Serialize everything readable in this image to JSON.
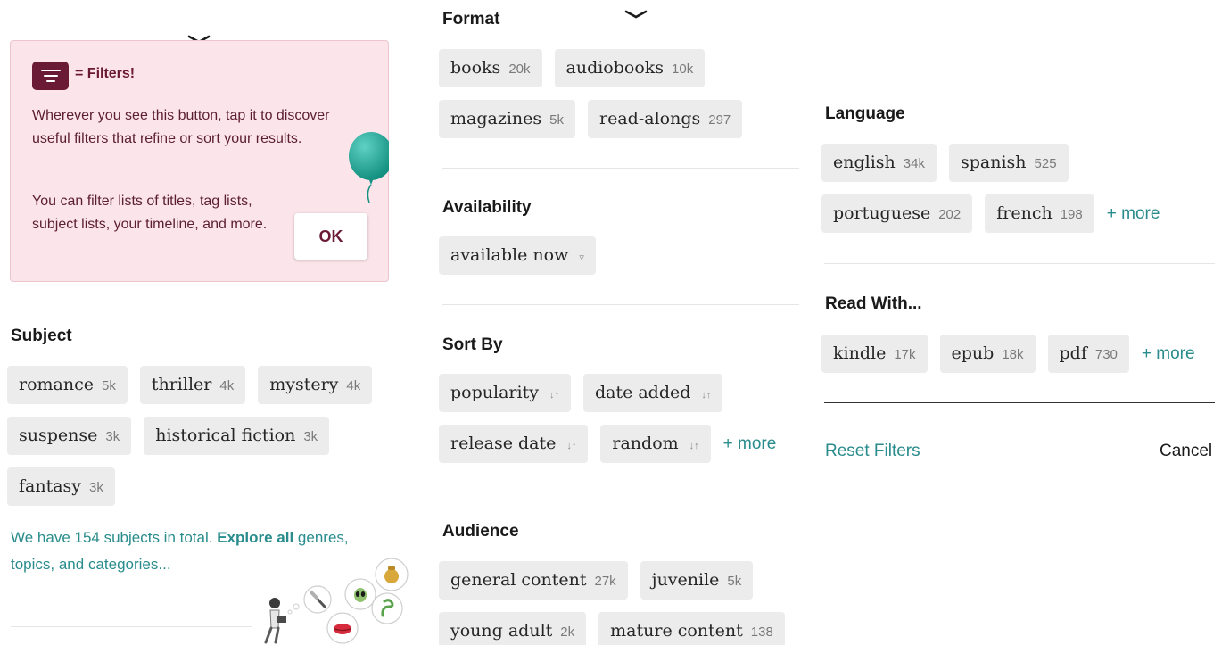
{
  "tooltip": {
    "title": "= Filters!",
    "body1": "Wherever you see this button, tap it to discover useful filters that refine or sort your results.",
    "body2": "You can filter lists of titles, tag lists, subject lists, your timeline, and more.",
    "ok_label": "OK"
  },
  "subject": {
    "title": "Subject",
    "chips": [
      {
        "label": "romance",
        "count": "5k"
      },
      {
        "label": "thriller",
        "count": "4k"
      },
      {
        "label": "mystery",
        "count": "4k"
      },
      {
        "label": "suspense",
        "count": "3k"
      },
      {
        "label": "historical fiction",
        "count": "3k"
      },
      {
        "label": "fantasy",
        "count": "3k"
      }
    ],
    "note_prefix": "We have 154 subjects in total. ",
    "note_link": "Explore all",
    "note_suffix": " genres, topics, and categories..."
  },
  "format": {
    "title": "Format",
    "chips": [
      {
        "label": "books",
        "count": "20k"
      },
      {
        "label": "audiobooks",
        "count": "10k"
      },
      {
        "label": "magazines",
        "count": "5k"
      },
      {
        "label": "read-alongs",
        "count": "297"
      }
    ]
  },
  "availability": {
    "title": "Availability",
    "chips": [
      {
        "label": "available now",
        "icon": "filter-icon"
      }
    ]
  },
  "sort_by": {
    "title": "Sort By",
    "chips": [
      {
        "label": "popularity",
        "icon": "sort-icon"
      },
      {
        "label": "date added",
        "icon": "sort-icon"
      },
      {
        "label": "release date",
        "icon": "sort-icon"
      },
      {
        "label": "random",
        "icon": "sort-icon"
      }
    ],
    "more_label": "+ more"
  },
  "audience": {
    "title": "Audience",
    "chips": [
      {
        "label": "general content",
        "count": "27k"
      },
      {
        "label": "juvenile",
        "count": "5k"
      },
      {
        "label": "young adult",
        "count": "2k"
      },
      {
        "label": "mature content",
        "count": "138"
      }
    ]
  },
  "language": {
    "title": "Language",
    "chips": [
      {
        "label": "english",
        "count": "34k"
      },
      {
        "label": "spanish",
        "count": "525"
      },
      {
        "label": "portuguese",
        "count": "202"
      },
      {
        "label": "french",
        "count": "198"
      }
    ],
    "more_label": "+ more"
  },
  "read_with": {
    "title": "Read With...",
    "chips": [
      {
        "label": "kindle",
        "count": "17k"
      },
      {
        "label": "epub",
        "count": "18k"
      },
      {
        "label": "pdf",
        "count": "730"
      }
    ],
    "more_label": "+ more"
  },
  "actions": {
    "reset_label": "Reset Filters",
    "cancel_label": "Cancel"
  },
  "colors": {
    "accent_teal": "#2a8c8c",
    "brand_maroon": "#6b1a35",
    "tooltip_bg": "#fbe4ea",
    "chip_bg": "#ececec",
    "balloon": "#1fa396"
  }
}
